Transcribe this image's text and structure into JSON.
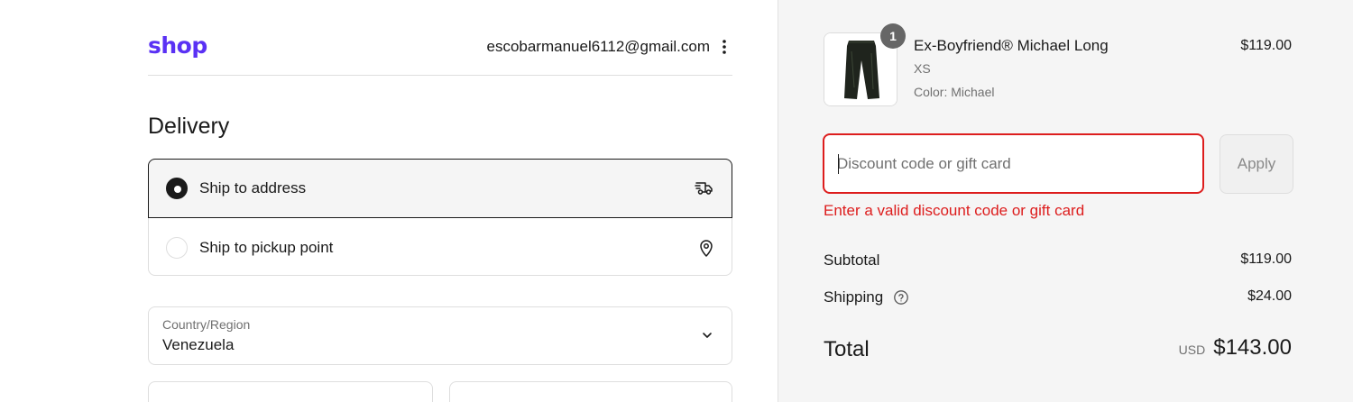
{
  "header": {
    "logo": "shop",
    "email": "escobarmanuel6112@gmail.com",
    "menu_icon": "kebab-menu-icon"
  },
  "delivery": {
    "title": "Delivery",
    "options": [
      {
        "label": "Ship to address",
        "selected": true,
        "icon": "truck-icon"
      },
      {
        "label": "Ship to pickup point",
        "selected": false,
        "icon": "location-pin-icon"
      }
    ],
    "country": {
      "label": "Country/Region",
      "value": "Venezuela"
    }
  },
  "summary": {
    "product": {
      "quantity": "1",
      "name": "Ex-Boyfriend® Michael Long",
      "size": "XS",
      "color": "Color: Michael",
      "price": "$119.00"
    },
    "discount": {
      "placeholder": "Discount code or gift card",
      "value": "",
      "apply_label": "Apply",
      "error": "Enter a valid discount code or gift card"
    },
    "subtotal": {
      "label": "Subtotal",
      "value": "$119.00"
    },
    "shipping": {
      "label": "Shipping",
      "value": "$24.00"
    },
    "total": {
      "label": "Total",
      "currency": "USD",
      "value": "$143.00"
    }
  },
  "colors": {
    "brand": "#5a31f4",
    "error": "#dd1d1d",
    "panel_bg": "#f5f5f5"
  }
}
